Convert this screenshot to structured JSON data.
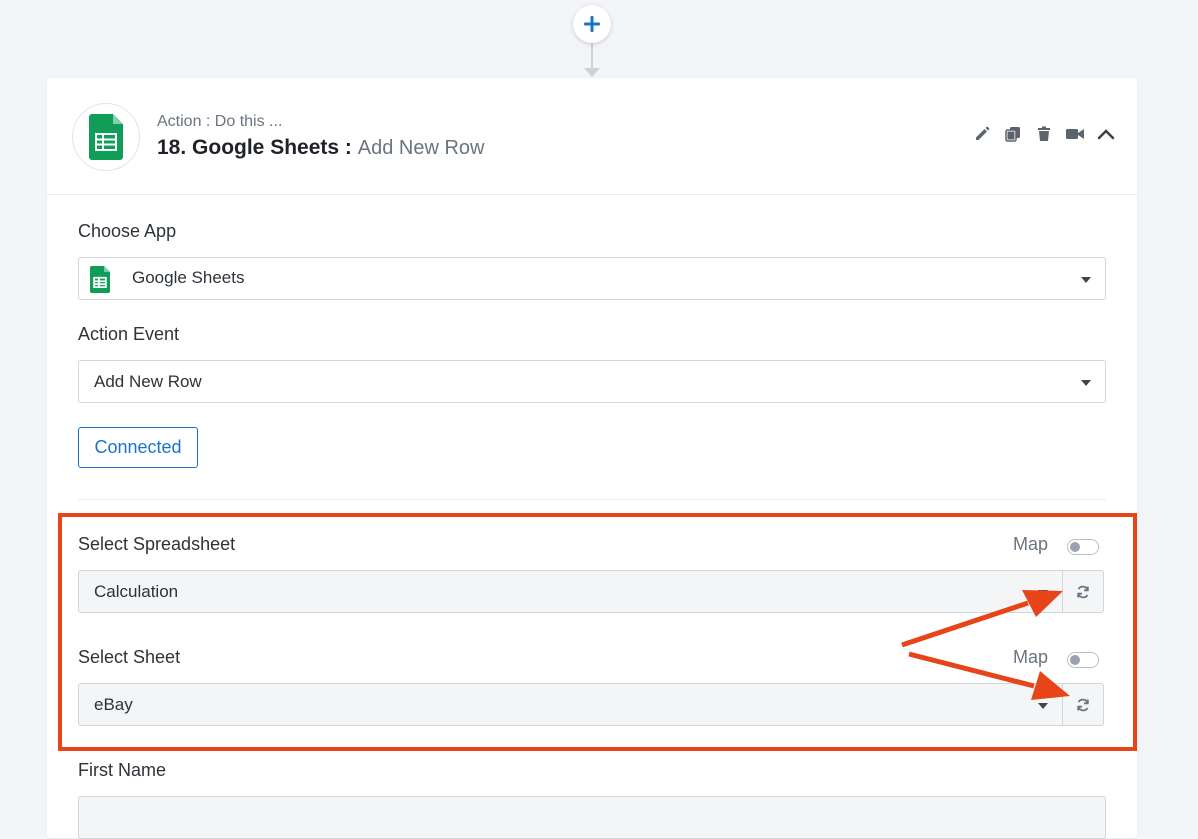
{
  "step": {
    "subtitle": "Action : Do this ...",
    "title": "18. Google Sheets :",
    "event": "Add New Row",
    "app_icon": "google-sheets-icon"
  },
  "header_tools": [
    "pencil-icon",
    "copy-icon",
    "trash-icon",
    "video-icon",
    "chevron-up-icon"
  ],
  "choose_app": {
    "label": "Choose App",
    "value": "Google Sheets"
  },
  "action_event": {
    "label": "Action Event",
    "value": "Add New Row"
  },
  "connection": {
    "label": "Connected"
  },
  "spreadsheet": {
    "label": "Select Spreadsheet",
    "map_label": "Map",
    "value": "Calculation"
  },
  "sheet": {
    "label": "Select Sheet",
    "map_label": "Map",
    "value": "eBay"
  },
  "first_name": {
    "label": "First Name"
  },
  "colors": {
    "accent": "#1a73c9",
    "highlight": "#e8441a",
    "sheets_green": "#0f9d58"
  }
}
